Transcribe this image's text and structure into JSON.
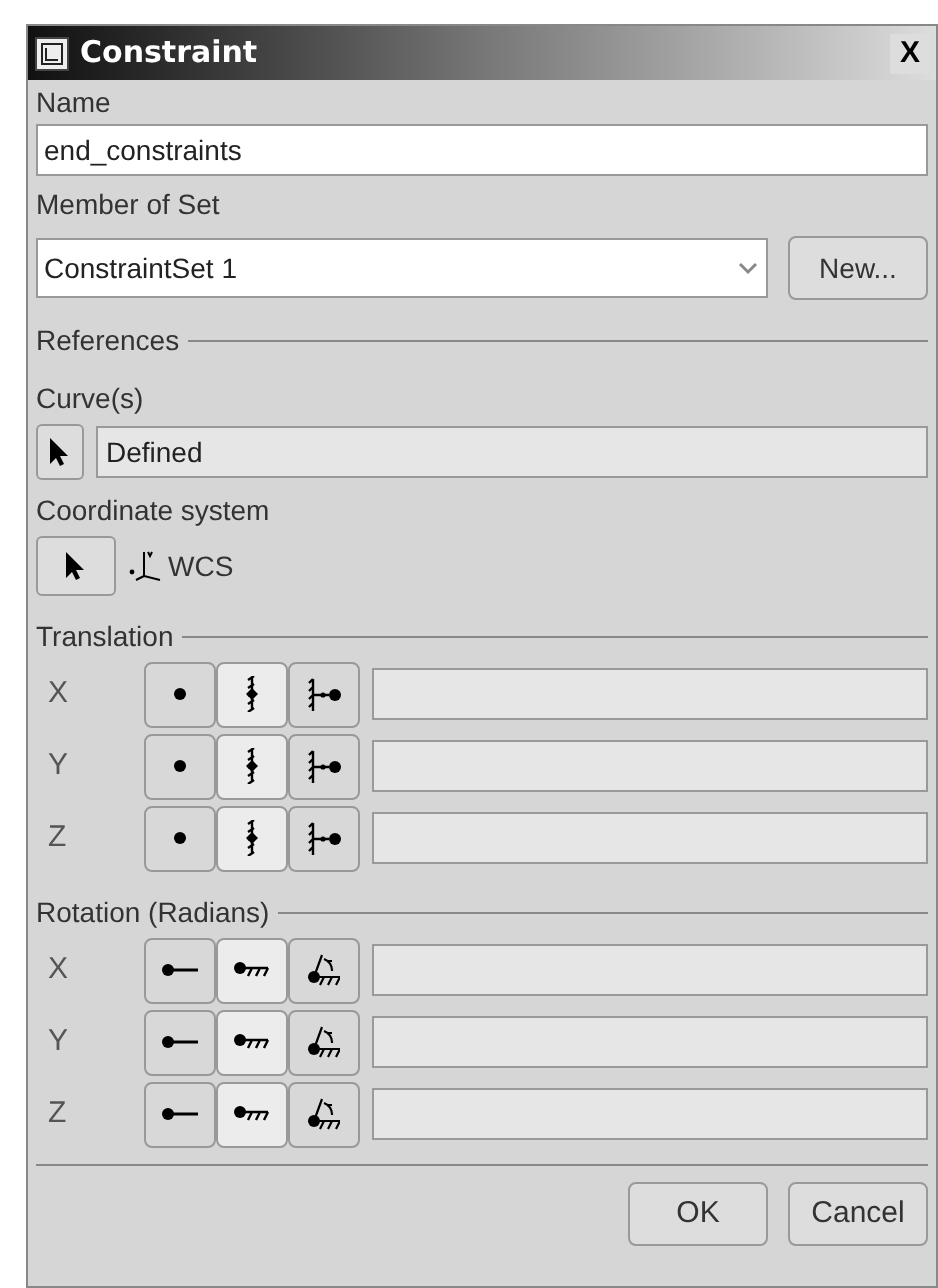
{
  "window": {
    "title": "Constraint",
    "close": "X"
  },
  "name": {
    "label": "Name",
    "value": "end_constraints"
  },
  "member_of_set": {
    "label": "Member of Set",
    "value": "ConstraintSet 1",
    "new_button": "New..."
  },
  "references": {
    "heading": "References",
    "curves_label": "Curve(s)",
    "curves_value": "Defined",
    "coordinate_label": "Coordinate system",
    "coordinate_value": "WCS"
  },
  "translation": {
    "heading": "Translation",
    "rows": [
      {
        "axis": "X",
        "options": [
          {
            "kind": "point",
            "selected": false
          },
          {
            "kind": "anchored",
            "selected": true
          },
          {
            "kind": "spring",
            "selected": false
          }
        ]
      },
      {
        "axis": "Y",
        "options": [
          {
            "kind": "point",
            "selected": false
          },
          {
            "kind": "anchored",
            "selected": true
          },
          {
            "kind": "spring",
            "selected": false
          }
        ]
      },
      {
        "axis": "Z",
        "options": [
          {
            "kind": "point",
            "selected": false
          },
          {
            "kind": "anchored",
            "selected": true
          },
          {
            "kind": "spring",
            "selected": false
          }
        ]
      }
    ]
  },
  "rotation": {
    "heading": "Rotation (Radians)",
    "rows": [
      {
        "axis": "X",
        "options": [
          {
            "kind": "rod",
            "selected": false
          },
          {
            "kind": "grounded",
            "selected": true
          },
          {
            "kind": "hinge",
            "selected": false
          }
        ]
      },
      {
        "axis": "Y",
        "options": [
          {
            "kind": "rod",
            "selected": false
          },
          {
            "kind": "grounded",
            "selected": true
          },
          {
            "kind": "hinge",
            "selected": false
          }
        ]
      },
      {
        "axis": "Z",
        "options": [
          {
            "kind": "rod",
            "selected": false
          },
          {
            "kind": "grounded",
            "selected": true
          },
          {
            "kind": "hinge",
            "selected": false
          }
        ]
      }
    ]
  },
  "buttons": [
    "OK",
    "Cancel"
  ]
}
